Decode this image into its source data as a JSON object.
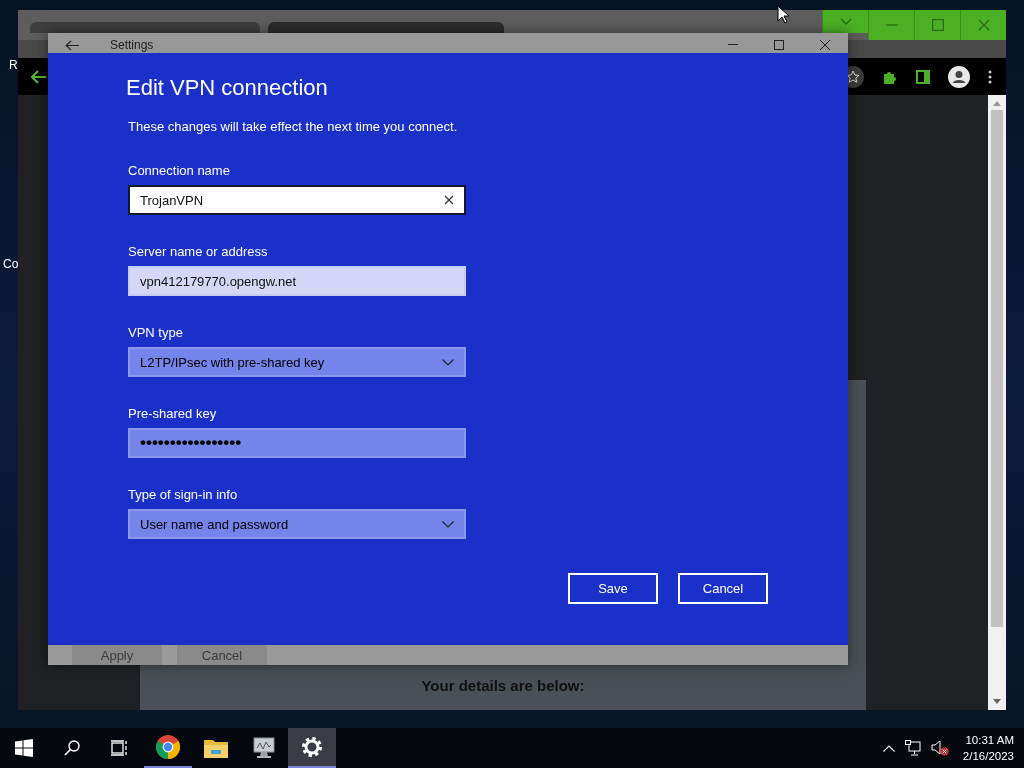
{
  "desktop": {
    "icon_labels": [
      "R",
      "Co"
    ]
  },
  "browser": {
    "page_heading": "Your details are below:"
  },
  "settings_window": {
    "title": "Settings",
    "footer_buttons": [
      {
        "label": "Apply",
        "disabled": true
      },
      {
        "label": "Cancel",
        "disabled": true
      }
    ]
  },
  "dialog": {
    "title": "Edit VPN connection",
    "note": "These changes will take effect the next time you connect.",
    "fields": [
      {
        "kind": "text",
        "label": "Connection name",
        "value": "TrojanVPN",
        "focused": true
      },
      {
        "kind": "text",
        "label": "Server name or address",
        "value": "vpn412179770.opengw.net",
        "focused": false
      },
      {
        "kind": "select",
        "label": "VPN type",
        "value": "L2TP/IPsec with pre-shared key",
        "focused": false
      },
      {
        "kind": "password",
        "label": "Pre-shared key",
        "value": "•••••••••••••••••",
        "focused": false
      },
      {
        "kind": "select",
        "label": "Type of sign-in info",
        "value": "User name and password",
        "focused": false
      }
    ],
    "buttons": [
      "Save",
      "Cancel"
    ]
  },
  "taskbar": {
    "apps": [
      {
        "kind": "chrome",
        "running": true,
        "selected": false
      },
      {
        "kind": "explorer",
        "running": false,
        "selected": false
      },
      {
        "kind": "monitor",
        "running": false,
        "selected": false
      },
      {
        "kind": "settings",
        "running": true,
        "selected": true
      }
    ],
    "clock": {
      "time": "10:31 AM",
      "date": "2/16/2023"
    }
  }
}
